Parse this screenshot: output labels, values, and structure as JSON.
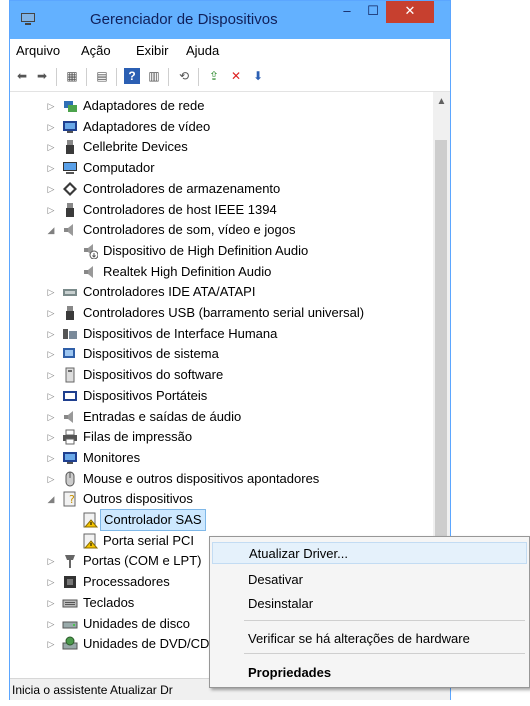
{
  "window": {
    "title": "Gerenciador de Dispositivos",
    "minimize": "–",
    "maximize": "☐",
    "close": "✕"
  },
  "menu": [
    "Arquivo",
    "Ação",
    "Exibir",
    "Ajuda"
  ],
  "toolbar": [
    "back-icon",
    "forward-icon",
    "grid-icon",
    "properties-icon",
    "help-icon",
    "view-icon",
    "scan-hardware-icon",
    "update-driver-icon",
    "uninstall-icon",
    "disable-icon"
  ],
  "tree": [
    {
      "label": "Adaptadores de rede",
      "icon": "network-icon",
      "level": 0,
      "expander": "▷"
    },
    {
      "label": "Adaptadores de vídeo",
      "icon": "display-adapter-icon",
      "level": 0,
      "expander": "▷"
    },
    {
      "label": "Cellebrite Devices",
      "icon": "usb-device-icon",
      "level": 0,
      "expander": "▷"
    },
    {
      "label": "Computador",
      "icon": "computer-icon",
      "level": 0,
      "expander": "▷"
    },
    {
      "label": "Controladores de armazenamento",
      "icon": "storage-controller-icon",
      "level": 0,
      "expander": "▷"
    },
    {
      "label": "Controladores de host IEEE 1394",
      "icon": "firewire-icon",
      "level": 0,
      "expander": "▷"
    },
    {
      "label": "Controladores de som, vídeo e jogos",
      "icon": "speaker-icon",
      "level": 0,
      "expander": "◢"
    },
    {
      "label": "Dispositivo de High Definition Audio",
      "icon": "speaker-warning-icon",
      "level": 1,
      "expander": ""
    },
    {
      "label": "Realtek High Definition Audio",
      "icon": "speaker-icon",
      "level": 1,
      "expander": ""
    },
    {
      "label": "Controladores IDE ATA/ATAPI",
      "icon": "ide-icon",
      "level": 0,
      "expander": "▷"
    },
    {
      "label": "Controladores USB (barramento serial universal)",
      "icon": "usb-icon",
      "level": 0,
      "expander": "▷"
    },
    {
      "label": "Dispositivos de Interface Humana",
      "icon": "hid-icon",
      "level": 0,
      "expander": "▷"
    },
    {
      "label": "Dispositivos de sistema",
      "icon": "system-device-icon",
      "level": 0,
      "expander": "▷"
    },
    {
      "label": "Dispositivos do software",
      "icon": "software-device-icon",
      "level": 0,
      "expander": "▷"
    },
    {
      "label": "Dispositivos Portáteis",
      "icon": "portable-device-icon",
      "level": 0,
      "expander": "▷"
    },
    {
      "label": "Entradas e saídas de áudio",
      "icon": "audio-io-icon",
      "level": 0,
      "expander": "▷"
    },
    {
      "label": "Filas de impressão",
      "icon": "printer-icon",
      "level": 0,
      "expander": "▷"
    },
    {
      "label": "Monitores",
      "icon": "monitor-icon",
      "level": 0,
      "expander": "▷"
    },
    {
      "label": "Mouse e outros dispositivos apontadores",
      "icon": "mouse-icon",
      "level": 0,
      "expander": "▷"
    },
    {
      "label": "Outros dispositivos",
      "icon": "unknown-device-icon",
      "level": 0,
      "expander": "◢"
    },
    {
      "label": "Controlador SAS",
      "icon": "warning-device-icon",
      "level": 1,
      "expander": "",
      "selected": true
    },
    {
      "label": "Porta serial PCI",
      "icon": "warning-device-icon",
      "level": 1,
      "expander": ""
    },
    {
      "label": "Portas (COM e LPT)",
      "icon": "port-icon",
      "level": 0,
      "expander": "▷"
    },
    {
      "label": "Processadores",
      "icon": "processor-icon",
      "level": 0,
      "expander": "▷"
    },
    {
      "label": "Teclados",
      "icon": "keyboard-icon",
      "level": 0,
      "expander": "▷"
    },
    {
      "label": "Unidades de disco",
      "icon": "disk-icon",
      "level": 0,
      "expander": "▷"
    },
    {
      "label": "Unidades de DVD/CD-ROM",
      "icon": "dvd-icon",
      "level": 0,
      "expander": "▷"
    }
  ],
  "context_menu": [
    {
      "label": "Atualizar Driver...",
      "highlighted": true
    },
    {
      "label": "Desativar"
    },
    {
      "label": "Desinstalar"
    },
    {
      "label": "Verificar se há alterações de hardware"
    },
    {
      "label": "Propriedades",
      "bold": true
    }
  ],
  "status": "Inicia o assistente Atualizar Dr",
  "scrollbar": {
    "up": "▲"
  }
}
